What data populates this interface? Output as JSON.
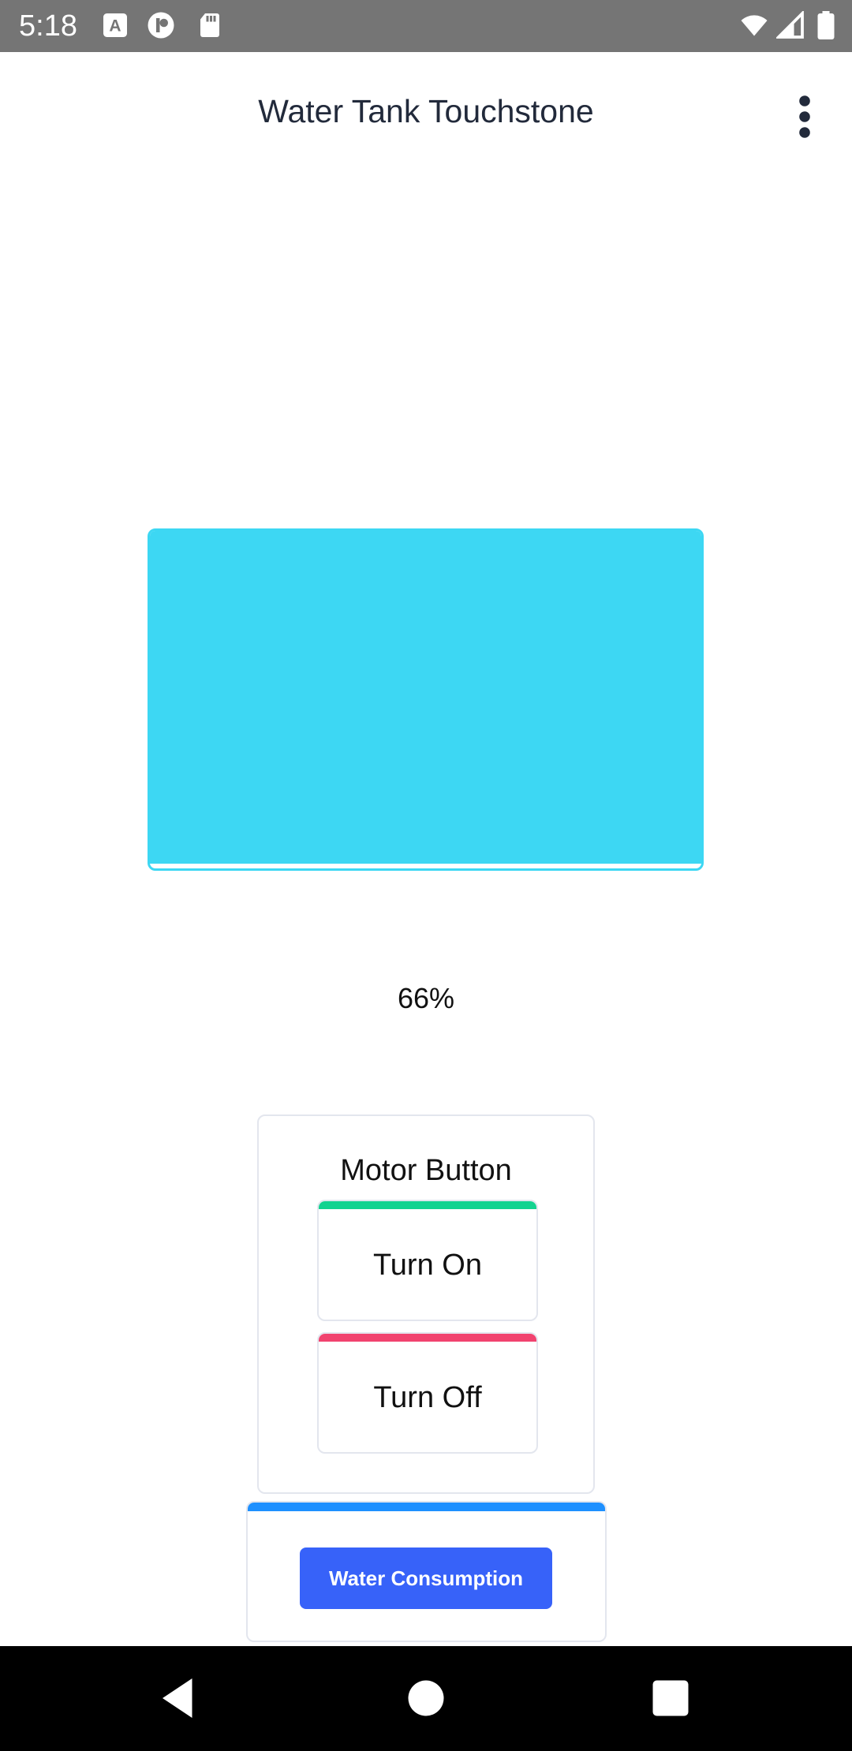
{
  "status_bar": {
    "time": "5:18",
    "left_icons": [
      "text-a-icon",
      "podcast-icon",
      "sd-card-icon"
    ],
    "right_icons": [
      "wifi-icon",
      "signal-icon",
      "battery-icon"
    ]
  },
  "header": {
    "title": "Water Tank Touchstone",
    "menu_icon": "more-vert-icon"
  },
  "tank": {
    "level_percent": 66,
    "level_label": "66%",
    "water_color": "#3dd7f3"
  },
  "motor": {
    "title": "Motor Button",
    "on_label": "Turn On",
    "off_label": "Turn Off",
    "on_color": "#13d390",
    "off_color": "#f1436f"
  },
  "consumption": {
    "button_label": "Water Consumption",
    "accent_color": "#1e90ff",
    "button_color": "#3762f9"
  },
  "nav_bar": {
    "icons": [
      "back-icon",
      "home-icon",
      "recents-icon"
    ]
  }
}
